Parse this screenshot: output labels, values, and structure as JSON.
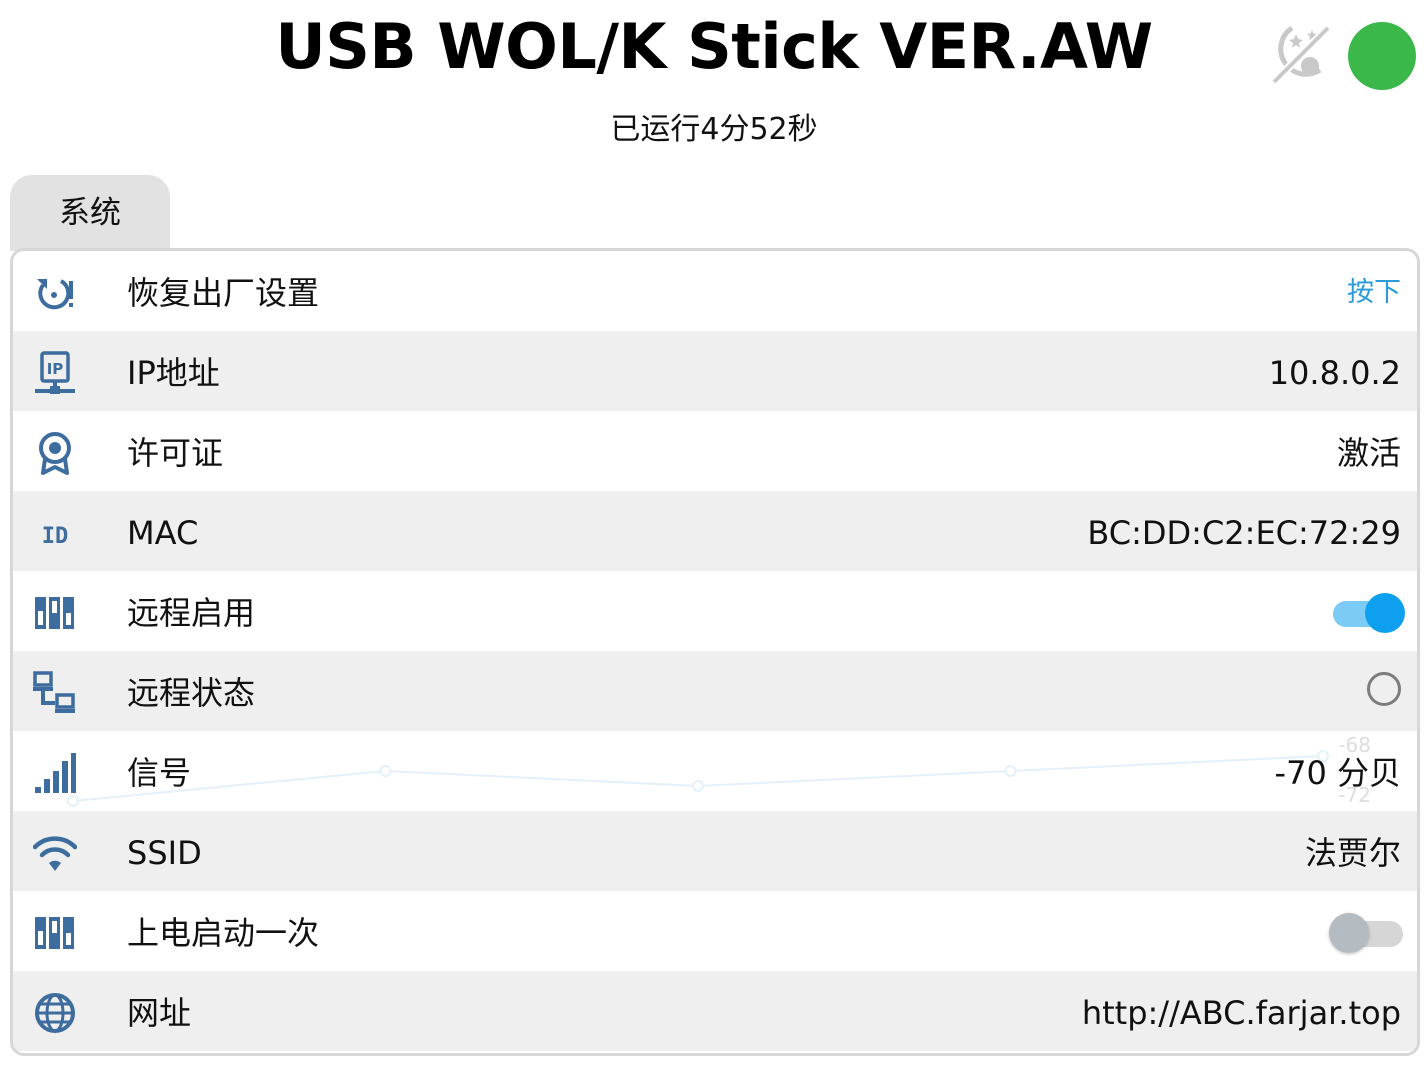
{
  "header": {
    "title": "USB WOL/K Stick VER.AW",
    "uptime": "已运行4分52秒",
    "status_color": "#3cb84a",
    "theme_icon": "night-mode-off-icon"
  },
  "tabs": [
    {
      "label": "系统"
    }
  ],
  "rows": {
    "factory_reset": {
      "icon": "reset-icon",
      "label": "恢复出厂设置",
      "action": "按下"
    },
    "ip": {
      "icon": "ip-network-icon",
      "label": "IP地址",
      "value": "10.8.0.2"
    },
    "license": {
      "icon": "certificate-icon",
      "label": "许可证",
      "value": "激活"
    },
    "mac": {
      "icon": "id-icon",
      "label": "MAC",
      "value": "BC:DD:C2:EC:72:29"
    },
    "remote_enable": {
      "icon": "panel-icon",
      "label": "远程启用",
      "toggle": true
    },
    "remote_status": {
      "icon": "lan-icon",
      "label": "远程状态",
      "checked": false
    },
    "signal": {
      "icon": "signal-bars-icon",
      "label": "信号",
      "value": "-70 分贝",
      "sparkline": [
        -72,
        -70,
        -71,
        -70,
        -69
      ],
      "tick_top": "-68",
      "tick_bottom": "-72"
    },
    "ssid": {
      "icon": "wifi-icon",
      "label": "SSID",
      "value": "法贾尔"
    },
    "power_on_boot": {
      "icon": "panel-icon",
      "label": "上电启动一次",
      "toggle": false
    },
    "url": {
      "icon": "globe-icon",
      "label": "网址",
      "value": "http://ABC.farjar.top"
    }
  },
  "colors": {
    "accent": "#0ea0ee",
    "icon": "#3d6d9e",
    "link": "#2a9bd8",
    "row_alt": "#efefef"
  }
}
